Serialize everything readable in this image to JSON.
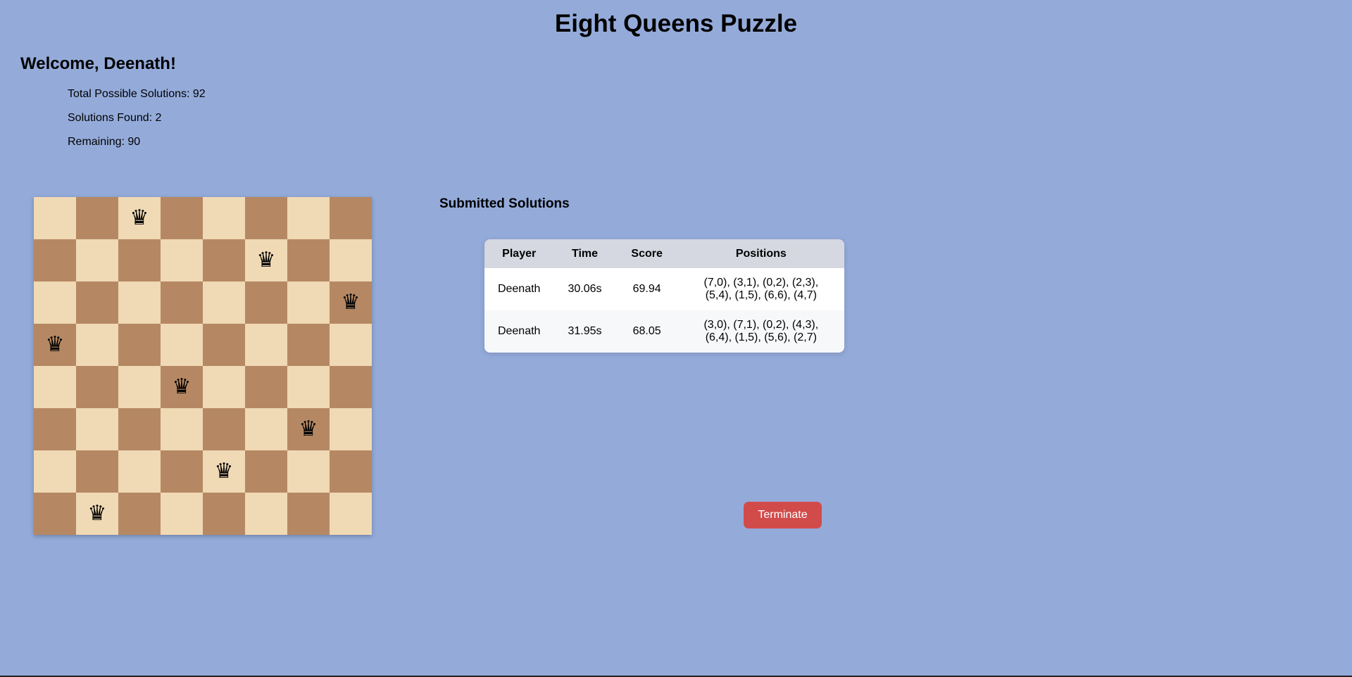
{
  "page": {
    "title": "Eight Queens Puzzle",
    "welcome": "Welcome, Deenath!"
  },
  "stats": {
    "total": "Total Possible Solutions: 92",
    "found": "Solutions Found: 2",
    "remaining": "Remaining: 90"
  },
  "board": {
    "size": 8,
    "queen_icon": "queen-icon",
    "queen_glyph": "♛",
    "light_color": "#f0d9b5",
    "dark_color": "#b58863",
    "queens": [
      {
        "row": 0,
        "col": 2
      },
      {
        "row": 1,
        "col": 5
      },
      {
        "row": 2,
        "col": 7
      },
      {
        "row": 3,
        "col": 0
      },
      {
        "row": 4,
        "col": 3
      },
      {
        "row": 5,
        "col": 6
      },
      {
        "row": 6,
        "col": 4
      },
      {
        "row": 7,
        "col": 1
      }
    ]
  },
  "solutions": {
    "heading": "Submitted Solutions",
    "columns": [
      "Player",
      "Time",
      "Score",
      "Positions"
    ],
    "rows": [
      {
        "player": "Deenath",
        "time": "30.06s",
        "score": "69.94",
        "positions": "(7,0), (3,1), (0,2), (2,3), (5,4), (1,5), (6,6), (4,7)"
      },
      {
        "player": "Deenath",
        "time": "31.95s",
        "score": "68.05",
        "positions": "(3,0), (7,1), (0,2), (4,3), (6,4), (1,5), (5,6), (2,7)"
      }
    ]
  },
  "actions": {
    "terminate_label": "Terminate",
    "terminate_color": "#d24b4b"
  },
  "colors": {
    "background": "#94abda"
  }
}
